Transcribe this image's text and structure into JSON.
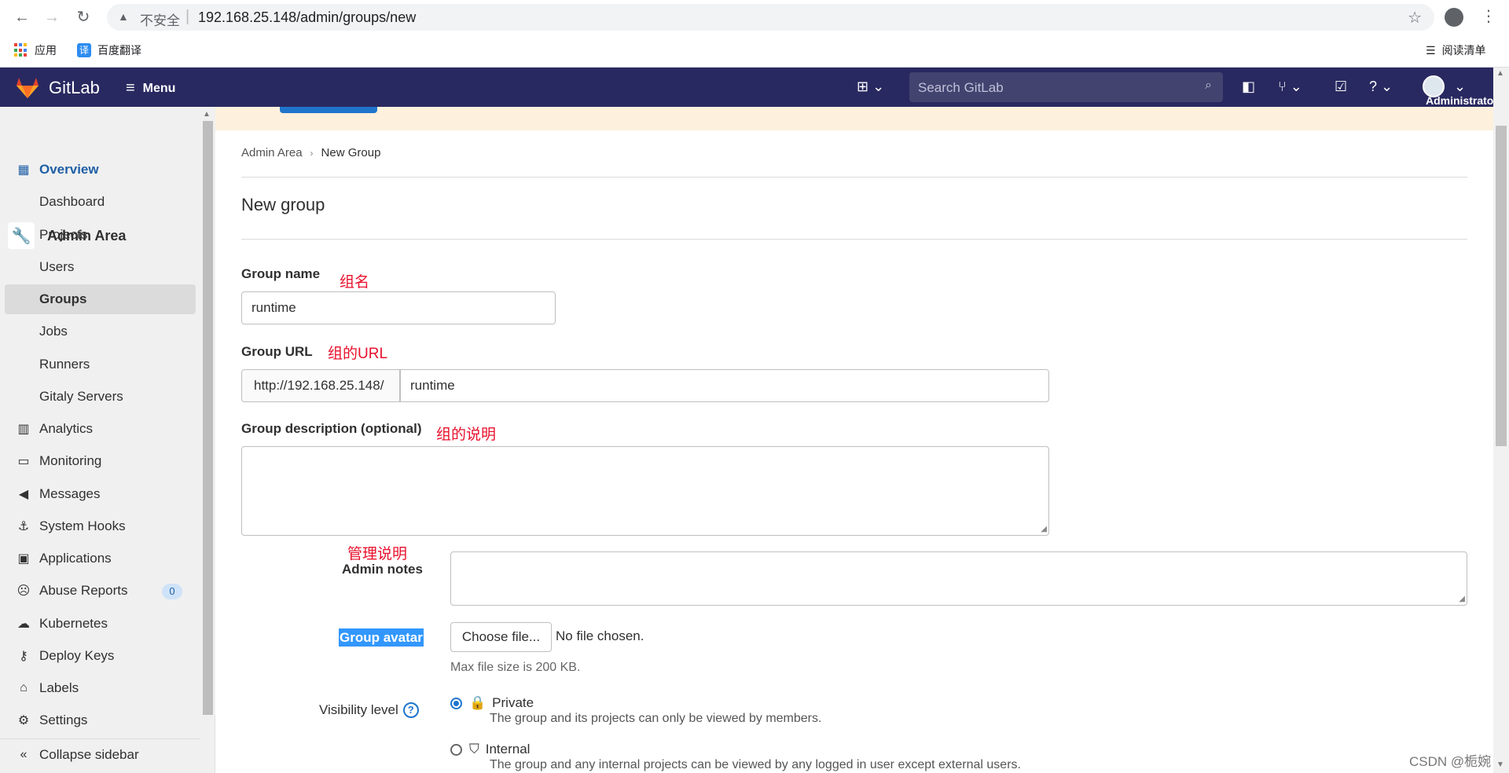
{
  "browser": {
    "insecure_label": "不安全",
    "url": "192.168.25.148/admin/groups/new",
    "bookmarks": [
      {
        "label": "应用"
      },
      {
        "label": "百度翻译"
      }
    ],
    "reading_list": "阅读清单"
  },
  "header": {
    "brand": "GitLab",
    "menu_label": "Menu",
    "search_placeholder": "Search GitLab",
    "user_name": "Administrator"
  },
  "sidebar": {
    "title": "Admin Area",
    "items": [
      {
        "label": "Overview"
      },
      {
        "label": "Dashboard"
      },
      {
        "label": "Projects"
      },
      {
        "label": "Users"
      },
      {
        "label": "Groups"
      },
      {
        "label": "Jobs"
      },
      {
        "label": "Runners"
      },
      {
        "label": "Gitaly Servers"
      },
      {
        "label": "Analytics"
      },
      {
        "label": "Monitoring"
      },
      {
        "label": "Messages"
      },
      {
        "label": "System Hooks"
      },
      {
        "label": "Applications"
      },
      {
        "label": "Abuse Reports",
        "badge": "0"
      },
      {
        "label": "Kubernetes"
      },
      {
        "label": "Deploy Keys"
      },
      {
        "label": "Labels"
      },
      {
        "label": "Settings"
      }
    ],
    "collapse_label": "Collapse sidebar"
  },
  "breadcrumb": {
    "parent": "Admin Area",
    "current": "New Group"
  },
  "page": {
    "title": "New group"
  },
  "form": {
    "group_name_label": "Group name",
    "group_name_note": "组名",
    "group_name_value": "runtime",
    "group_url_label": "Group URL",
    "group_url_note": "组的URL",
    "group_url_prefix": "http://192.168.25.148/",
    "group_url_value": "runtime",
    "description_label": "Group description (optional)",
    "description_note": "组的说明",
    "admin_notes_note": "管理说明",
    "admin_notes_label": "Admin notes",
    "avatar_label": "Group avatar",
    "choose_file": "Choose file...",
    "no_file": "No file chosen.",
    "max_size": "Max file size is 200 KB.",
    "visibility_label": "Visibility level",
    "visibility_options": [
      {
        "label": "Private",
        "description": "The group and its projects can only be viewed by members.",
        "selected": true
      },
      {
        "label": "Internal",
        "description": "The group and any internal projects can be viewed by any logged in user except external users.",
        "selected": false
      }
    ]
  },
  "watermark": "CSDN @栀婉"
}
